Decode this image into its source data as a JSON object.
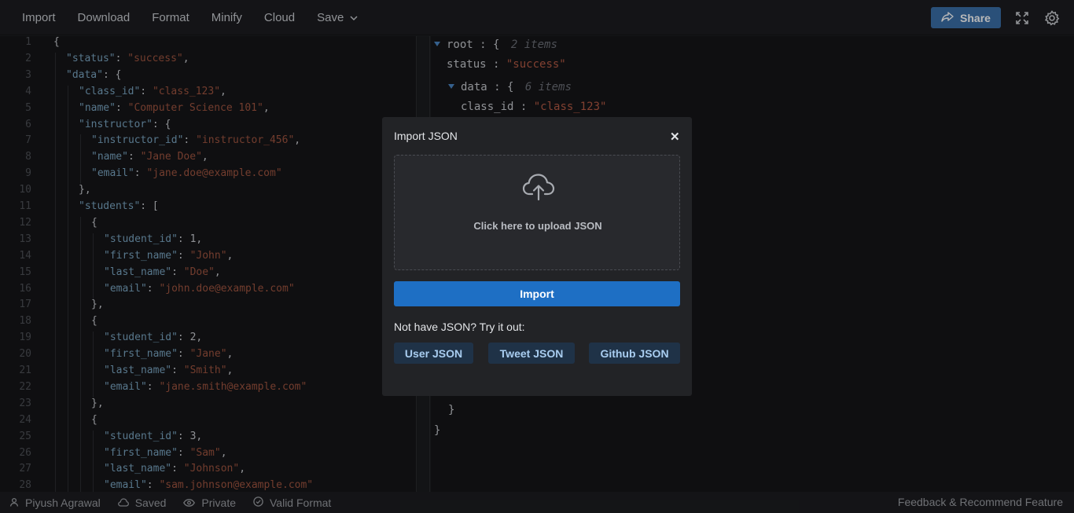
{
  "toolbar": {
    "menu": [
      {
        "label": "Import",
        "name": "menu-import"
      },
      {
        "label": "Download",
        "name": "menu-download"
      },
      {
        "label": "Format",
        "name": "menu-format"
      },
      {
        "label": "Minify",
        "name": "menu-minify"
      },
      {
        "label": "Cloud",
        "name": "menu-cloud"
      },
      {
        "label": "Save",
        "name": "menu-save"
      }
    ],
    "share_label": "Share",
    "icons": [
      "share-icon",
      "fullscreen-icon",
      "gear-icon",
      "chevron-down-icon"
    ]
  },
  "editor": {
    "lines": [
      {
        "n": "1",
        "i": 0,
        "t": [
          [
            "n",
            "{"
          ]
        ]
      },
      {
        "n": "2",
        "i": 1,
        "t": [
          [
            "k",
            "\"status\""
          ],
          [
            "n",
            ": "
          ],
          [
            "s",
            "\"success\""
          ],
          [
            "n",
            ","
          ]
        ]
      },
      {
        "n": "3",
        "i": 1,
        "t": [
          [
            "k",
            "\"data\""
          ],
          [
            "n",
            ": {"
          ]
        ]
      },
      {
        "n": "4",
        "i": 2,
        "t": [
          [
            "k",
            "\"class_id\""
          ],
          [
            "n",
            ": "
          ],
          [
            "s",
            "\"class_123\""
          ],
          [
            "n",
            ","
          ]
        ]
      },
      {
        "n": "5",
        "i": 2,
        "t": [
          [
            "k",
            "\"name\""
          ],
          [
            "n",
            ": "
          ],
          [
            "s",
            "\"Computer Science 101\""
          ],
          [
            "n",
            ","
          ]
        ]
      },
      {
        "n": "6",
        "i": 2,
        "t": [
          [
            "k",
            "\"instructor\""
          ],
          [
            "n",
            ": {"
          ]
        ]
      },
      {
        "n": "7",
        "i": 3,
        "t": [
          [
            "k",
            "\"instructor_id\""
          ],
          [
            "n",
            ": "
          ],
          [
            "s",
            "\"instructor_456\""
          ],
          [
            "n",
            ","
          ]
        ]
      },
      {
        "n": "8",
        "i": 3,
        "t": [
          [
            "k",
            "\"name\""
          ],
          [
            "n",
            ": "
          ],
          [
            "s",
            "\"Jane Doe\""
          ],
          [
            "n",
            ","
          ]
        ]
      },
      {
        "n": "9",
        "i": 3,
        "t": [
          [
            "k",
            "\"email\""
          ],
          [
            "n",
            ": "
          ],
          [
            "s",
            "\"jane.doe@example.com\""
          ]
        ]
      },
      {
        "n": "10",
        "i": 2,
        "t": [
          [
            "n",
            "},"
          ]
        ]
      },
      {
        "n": "11",
        "i": 2,
        "t": [
          [
            "k",
            "\"students\""
          ],
          [
            "n",
            ": ["
          ]
        ]
      },
      {
        "n": "12",
        "i": 3,
        "t": [
          [
            "n",
            "{"
          ]
        ]
      },
      {
        "n": "13",
        "i": 4,
        "t": [
          [
            "k",
            "\"student_id\""
          ],
          [
            "n",
            ": 1,"
          ]
        ]
      },
      {
        "n": "14",
        "i": 4,
        "t": [
          [
            "k",
            "\"first_name\""
          ],
          [
            "n",
            ": "
          ],
          [
            "s",
            "\"John\""
          ],
          [
            "n",
            ","
          ]
        ]
      },
      {
        "n": "15",
        "i": 4,
        "t": [
          [
            "k",
            "\"last_name\""
          ],
          [
            "n",
            ": "
          ],
          [
            "s",
            "\"Doe\""
          ],
          [
            "n",
            ","
          ]
        ]
      },
      {
        "n": "16",
        "i": 4,
        "t": [
          [
            "k",
            "\"email\""
          ],
          [
            "n",
            ": "
          ],
          [
            "s",
            "\"john.doe@example.com\""
          ]
        ]
      },
      {
        "n": "17",
        "i": 3,
        "t": [
          [
            "n",
            "},"
          ]
        ]
      },
      {
        "n": "18",
        "i": 3,
        "t": [
          [
            "n",
            "{"
          ]
        ]
      },
      {
        "n": "19",
        "i": 4,
        "t": [
          [
            "k",
            "\"student_id\""
          ],
          [
            "n",
            ": 2,"
          ]
        ]
      },
      {
        "n": "20",
        "i": 4,
        "t": [
          [
            "k",
            "\"first_name\""
          ],
          [
            "n",
            ": "
          ],
          [
            "s",
            "\"Jane\""
          ],
          [
            "n",
            ","
          ]
        ]
      },
      {
        "n": "21",
        "i": 4,
        "t": [
          [
            "k",
            "\"last_name\""
          ],
          [
            "n",
            ": "
          ],
          [
            "s",
            "\"Smith\""
          ],
          [
            "n",
            ","
          ]
        ]
      },
      {
        "n": "22",
        "i": 4,
        "t": [
          [
            "k",
            "\"email\""
          ],
          [
            "n",
            ": "
          ],
          [
            "s",
            "\"jane.smith@example.com\""
          ]
        ]
      },
      {
        "n": "23",
        "i": 3,
        "t": [
          [
            "n",
            "},"
          ]
        ]
      },
      {
        "n": "24",
        "i": 3,
        "t": [
          [
            "n",
            "{"
          ]
        ]
      },
      {
        "n": "25",
        "i": 4,
        "t": [
          [
            "k",
            "\"student_id\""
          ],
          [
            "n",
            ": 3,"
          ]
        ]
      },
      {
        "n": "26",
        "i": 4,
        "t": [
          [
            "k",
            "\"first_name\""
          ],
          [
            "n",
            ": "
          ],
          [
            "s",
            "\"Sam\""
          ],
          [
            "n",
            ","
          ]
        ]
      },
      {
        "n": "27",
        "i": 4,
        "t": [
          [
            "k",
            "\"last_name\""
          ],
          [
            "n",
            ": "
          ],
          [
            "s",
            "\"Johnson\""
          ],
          [
            "n",
            ","
          ]
        ]
      },
      {
        "n": "28",
        "i": 4,
        "t": [
          [
            "k",
            "\"email\""
          ],
          [
            "n",
            ": "
          ],
          [
            "s",
            "\"sam.johnson@example.com\""
          ]
        ]
      }
    ]
  },
  "tree": {
    "root_key": "root",
    "root_count": "2 items",
    "status_key": "status",
    "status_value": "\"success\"",
    "data_key": "data",
    "data_count": "6 items",
    "class_id_key": "class_id",
    "class_id_value": "\"class_123\"",
    "close_inner": "}",
    "close_outer": "}"
  },
  "modal": {
    "title": "Import JSON",
    "close_glyph": "✕",
    "upload_text": "Click here to upload JSON",
    "import_label": "Import",
    "try_text": "Not have JSON? Try it out:",
    "samples": [
      "User JSON",
      "Tweet JSON",
      "Github JSON"
    ]
  },
  "statusbar": {
    "user": "Piyush Agrawal",
    "saved": "Saved",
    "privacy": "Private",
    "validity": "Valid Format",
    "feedback": "Feedback & Recommend Feature"
  },
  "colors": {
    "accent": "#1e6fc4",
    "json_key": "#7aa6c2",
    "json_string": "#a05540",
    "share_button": "#3b6fa8"
  }
}
